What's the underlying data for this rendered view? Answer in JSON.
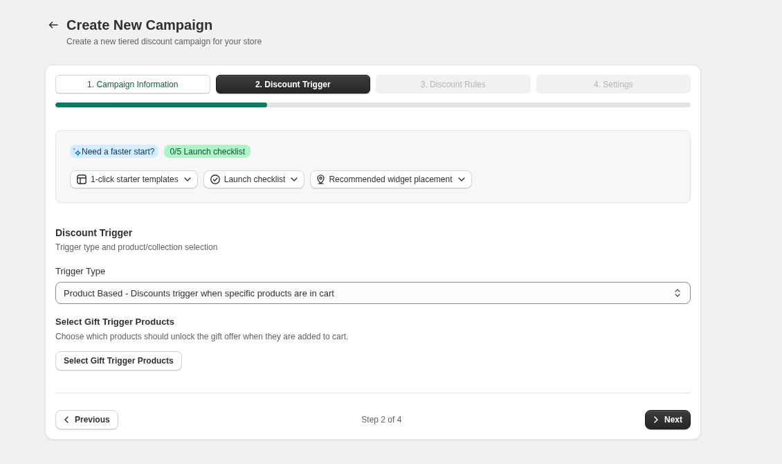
{
  "header": {
    "title": "Create New Campaign",
    "subtitle": "Create a new tiered discount campaign for your store"
  },
  "steps": [
    {
      "label": "1. Campaign Information",
      "selected": false,
      "completed": true,
      "disabled": false
    },
    {
      "label": "2. Discount Trigger",
      "selected": true,
      "completed": false,
      "disabled": false
    },
    {
      "label": "3. Discount Rules",
      "selected": false,
      "completed": false,
      "disabled": true
    },
    {
      "label": "4. Settings",
      "selected": false,
      "completed": false,
      "disabled": true
    }
  ],
  "progress": {
    "level": 0.333
  },
  "quick_start": {
    "badges": [
      {
        "label": "Need a faster start?",
        "kind": "hint"
      },
      {
        "label": "0/5 Launch checklist",
        "kind": "checklist"
      }
    ],
    "menus": [
      {
        "label": "1-click starter templates",
        "kind": "templates"
      },
      {
        "label": "Launch checklist",
        "kind": "checklist"
      },
      {
        "label": "Recommended widget placement",
        "kind": "placement"
      }
    ]
  },
  "section": {
    "title": "Discount Trigger",
    "subtitle": "Trigger type and product/collection selection"
  },
  "trigger_type": {
    "label": "Trigger Type",
    "value": "Product Based - Discounts trigger when specific products are in cart"
  },
  "gift_products": {
    "title": "Select Gift Trigger Products",
    "description": "Choose which products should unlock the gift offer when they are added to cart.",
    "button": "Select Gift Trigger Products"
  },
  "footer": {
    "previous": "Previous",
    "step": "Step 2 of 4",
    "next": "Next"
  }
}
